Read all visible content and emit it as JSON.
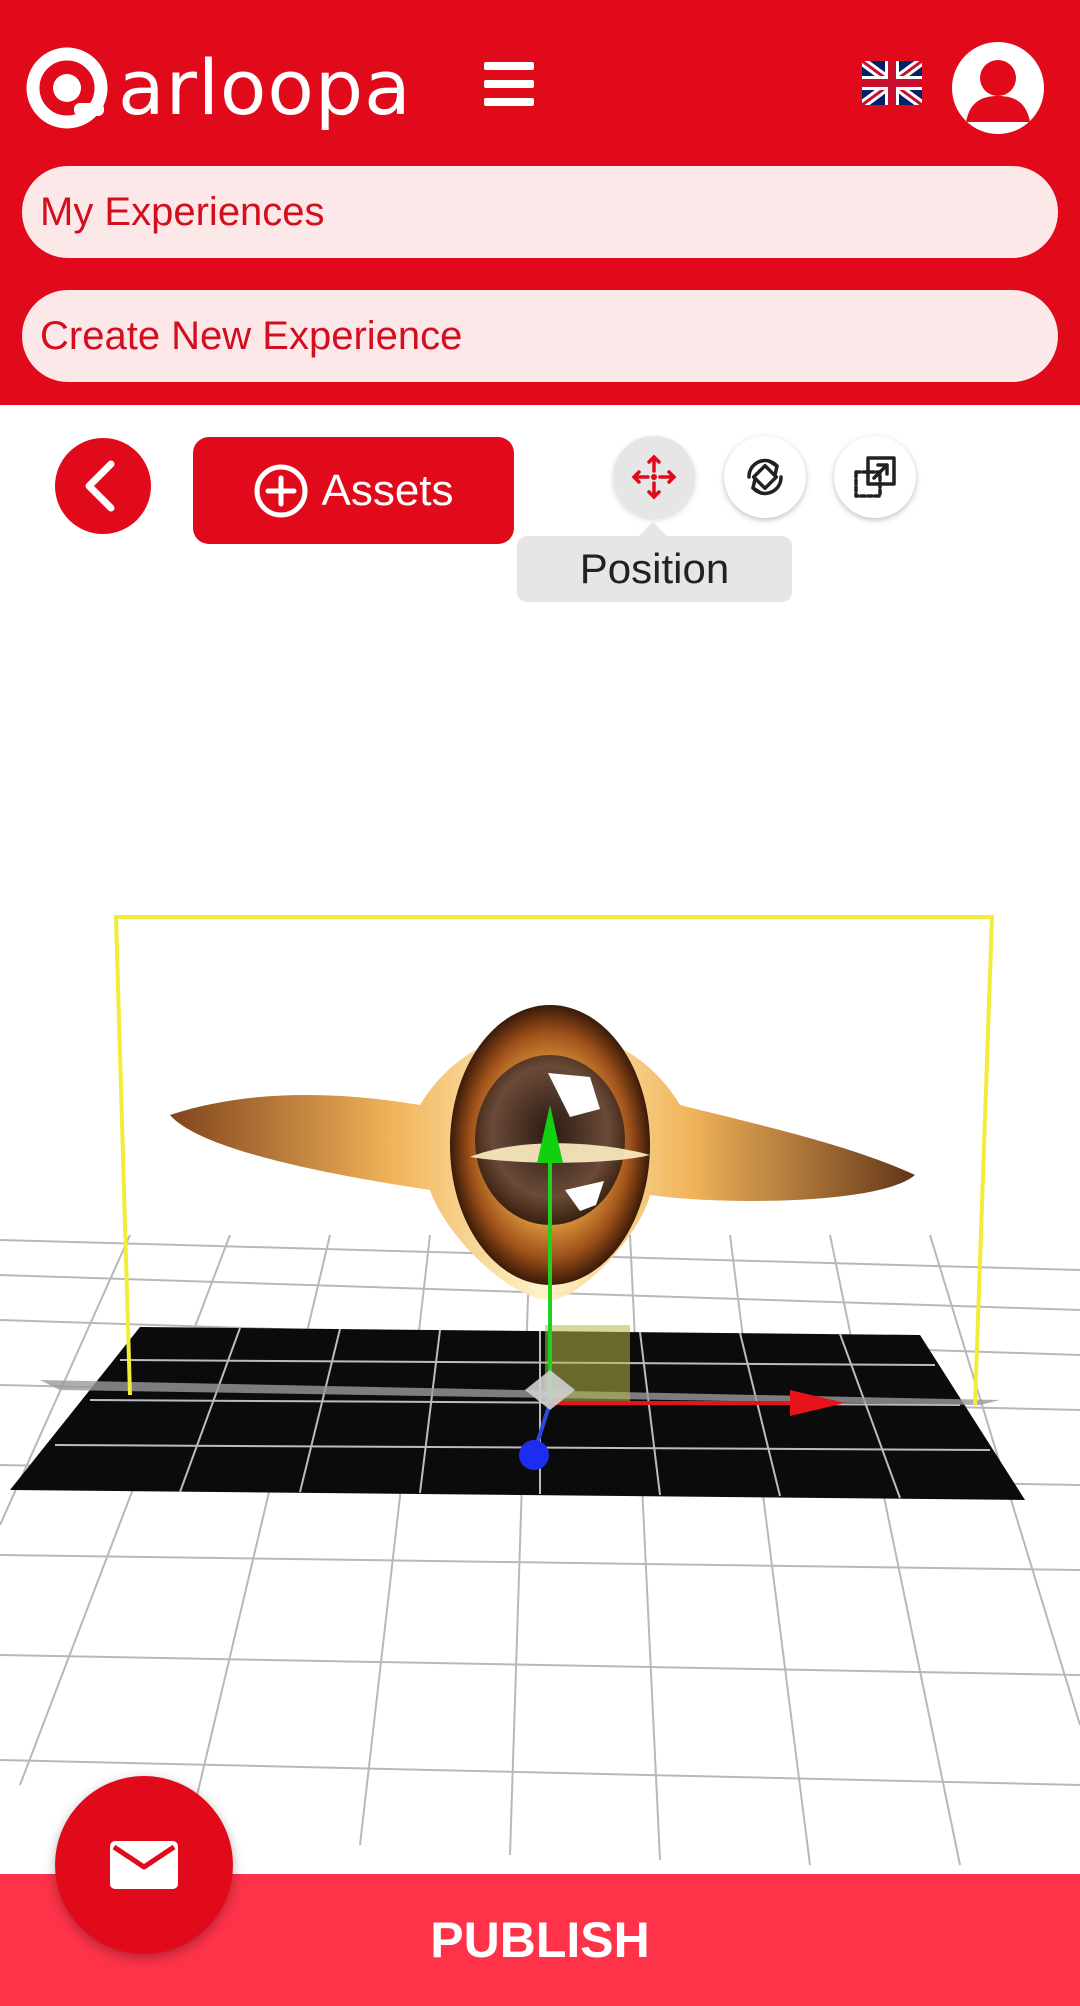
{
  "header": {
    "brand": "arloopa",
    "nav": {
      "my_experiences": "My Experiences",
      "create_new": "Create New Experience"
    }
  },
  "toolbar": {
    "assets_label": "Assets",
    "tooltip": "Position",
    "tools": [
      "position-icon",
      "rotate-icon",
      "scale-icon"
    ]
  },
  "footer": {
    "publish_label": "PUBLISH"
  },
  "colors": {
    "brand_red": "#e10a1b",
    "publish_red": "#fe3349",
    "pill_bg": "#fde8e9"
  }
}
